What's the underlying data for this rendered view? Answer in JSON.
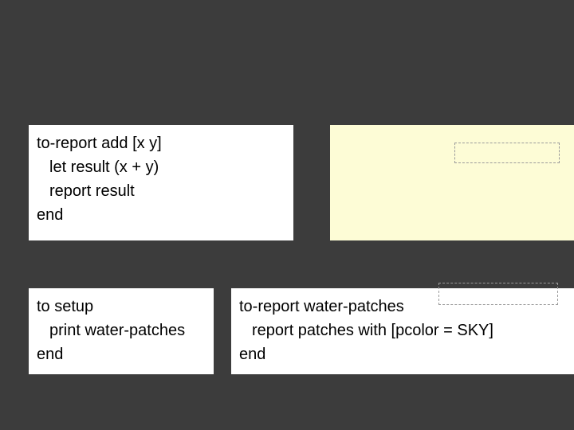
{
  "block1": {
    "l1": "to-report add [x y]",
    "l2": "let result (x + y)",
    "l3": "report result",
    "l4": "end"
  },
  "block2": {
    "l1": "to setup",
    "l2": "print water-patches",
    "l3": "end"
  },
  "block3": {
    "l1": "to-report water-patches",
    "l2": "report patches with [pcolor = SKY]",
    "l3": "end"
  }
}
